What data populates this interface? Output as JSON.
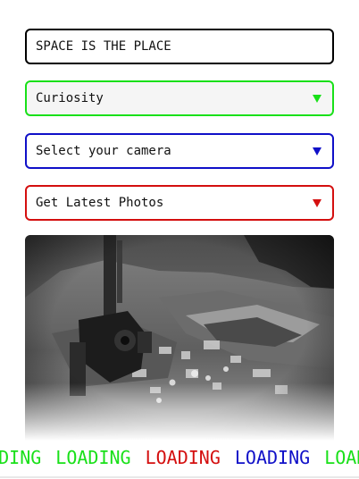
{
  "search": {
    "value": "SPACE IS THE PLACE"
  },
  "rover_select": {
    "value": "Curiosity",
    "accent": "#19e019"
  },
  "camera_select": {
    "value": "Select your camera",
    "accent": "#1010c8"
  },
  "photos_button": {
    "label": "Get Latest Photos",
    "accent": "#d40f0f"
  },
  "ticker": {
    "items": [
      {
        "text": "LOADING",
        "color": "#19e019"
      },
      {
        "text": "LOADING",
        "color": "#19e019"
      },
      {
        "text": "LOADING",
        "color": "#d40f0f"
      },
      {
        "text": "LOADING",
        "color": "#1010c8"
      },
      {
        "text": "LOADING",
        "color": "#19e019"
      }
    ]
  }
}
